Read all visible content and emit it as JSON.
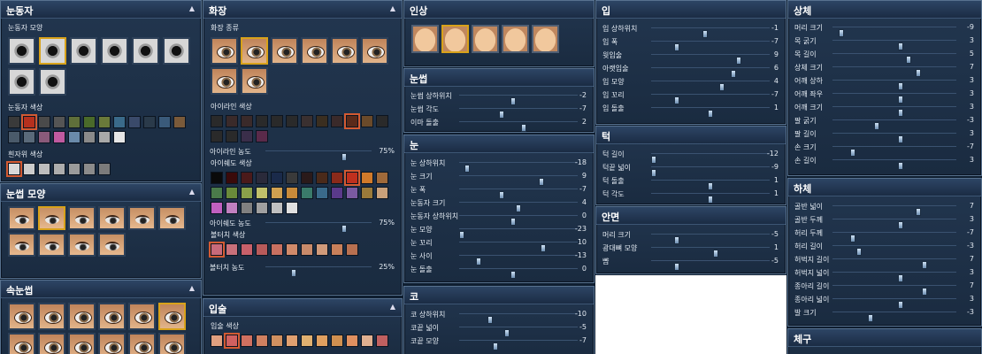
{
  "colors": {
    "accent": "#d8a21a",
    "selected_swatch": "#d35a32",
    "bg": "#0f1e30"
  },
  "col1": {
    "pupil": {
      "title": "눈동자",
      "shape_label": "눈동자 모양",
      "color_label": "눈동자 색상",
      "white_label": "흰자위 색상",
      "colors": [
        "#3a3a3a",
        "#b5301e",
        "#4a4a4a",
        "#555",
        "#5f6f3a",
        "#4a6a2a",
        "#6a7a3a",
        "#3a6a8a",
        "#3a4a6a",
        "#2a3a4a",
        "#3a5a7a",
        "#7a5a3a",
        "#4a5a6a",
        "#5a6a7a",
        "#8a5a7a",
        "#c05aa0",
        "#6a8aaa",
        "#8a8a8a",
        "#a9a9a9",
        "#e6e6e6"
      ],
      "whites": [
        "#d8d8d8",
        "#cccccc",
        "#bdbdbd",
        "#adadad",
        "#9b9b9b",
        "#8b8b8b",
        "#7b7b7b"
      ]
    },
    "eye_shape": {
      "title": "눈썹 모양"
    },
    "lashes": {
      "title": "속눈썹"
    }
  },
  "col2": {
    "makeup": {
      "title": "화장",
      "kind_label": "화장 종류",
      "liner_label": "아이라인 색상",
      "liner_density": "아이라인 농도",
      "liner_density_val": "75%",
      "liner_density_pos": 0.75,
      "shadow_label": "아이쉐도 색상",
      "shadow_density": "아이쉐도 농도",
      "shadow_density_val": "75%",
      "shadow_density_pos": 0.75,
      "blush_label": "볼터치 색상",
      "blush_density": "볼터치 농도",
      "blush_density_val": "25%",
      "blush_density_pos": 0.25,
      "liner": [
        "#2a2a2a",
        "#3a2a2a",
        "#3a2a2a",
        "#2a2a2a",
        "#2a2a2a",
        "#2a2a2a",
        "#3a3030",
        "#3a2e20",
        "#3a2a2a",
        "#5a2a1a",
        "#6a4a2a",
        "#2a2a2a",
        "#2a2a2a",
        "#2a2a2a",
        "#3a2e4a",
        "#5a2a4a"
      ],
      "shadow": [
        "#0a0a0a",
        "#3a0a0a",
        "#4a1a1a",
        "#2a2a3a",
        "#1a2a4a",
        "#3a3a3a",
        "#2a1a1a",
        "#4a2a1a",
        "#8a2a1a",
        "#c0301e",
        "#d07a2a",
        "#a06a3a",
        "#4a7a4a",
        "#6a8a3a",
        "#8aa04a",
        "#c0c06a",
        "#d0a050",
        "#c88a3a",
        "#3a7a6a",
        "#3a6a8a",
        "#5a3a8a",
        "#7a5aa0",
        "#9a7a3a",
        "#c8a07a",
        "#c060c0",
        "#c080c0",
        "#808080",
        "#a0a0a0",
        "#c0c0c0",
        "#e0e0e0"
      ],
      "blush": [
        "#c86a7a",
        "#c8707a",
        "#c8606a",
        "#b85a5a",
        "#c87060",
        "#d08a6a",
        "#c88a6a",
        "#d09a7a",
        "#c8805a",
        "#b87050"
      ]
    },
    "lips": {
      "title": "입술",
      "color_label": "입술 색상"
    }
  },
  "col3": {
    "impression": {
      "title": "인상"
    },
    "brows": {
      "title": "눈썹",
      "rows": [
        {
          "label": "눈썹 상하위치",
          "value": "-2",
          "pos": 0.45
        },
        {
          "label": "눈썹 각도",
          "value": "-7",
          "pos": 0.35
        },
        {
          "label": "이마 돌출",
          "value": "2",
          "pos": 0.55
        }
      ]
    },
    "eyes": {
      "title": "눈",
      "rows": [
        {
          "label": "눈 상하위치",
          "value": "-18",
          "pos": 0.05
        },
        {
          "label": "눈 크기",
          "value": "9",
          "pos": 0.7
        },
        {
          "label": "눈 폭",
          "value": "-7",
          "pos": 0.35
        },
        {
          "label": "눈동자 크기",
          "value": "4",
          "pos": 0.5
        },
        {
          "label": "눈동자 상하위치",
          "value": "0",
          "pos": 0.45
        },
        {
          "label": "눈 모양",
          "value": "-23",
          "pos": 0.0
        },
        {
          "label": "눈 꼬리",
          "value": "10",
          "pos": 0.72
        },
        {
          "label": "눈 사이",
          "value": "-13",
          "pos": 0.15
        },
        {
          "label": "눈 돌출",
          "value": "0",
          "pos": 0.45
        }
      ]
    },
    "nose": {
      "title": "코",
      "rows": [
        {
          "label": "코 상하위치",
          "value": "-10",
          "pos": 0.25
        },
        {
          "label": "코끝 넓이",
          "value": "-5",
          "pos": 0.4
        },
        {
          "label": "코끝 모양",
          "value": "-7",
          "pos": 0.3
        }
      ]
    }
  },
  "col4": {
    "mouth": {
      "title": "입",
      "rows": [
        {
          "label": "입 상하위치",
          "value": "-1",
          "pos": 0.45
        },
        {
          "label": "입 폭",
          "value": "-7",
          "pos": 0.2
        },
        {
          "label": "윗입술",
          "value": "9",
          "pos": 0.75
        },
        {
          "label": "아랫입술",
          "value": "6",
          "pos": 0.7
        },
        {
          "label": "입 모양",
          "value": "4",
          "pos": 0.6
        },
        {
          "label": "입 꼬리",
          "value": "-7",
          "pos": 0.2
        },
        {
          "label": "입 돌출",
          "value": "1",
          "pos": 0.5
        }
      ]
    },
    "chin": {
      "title": "턱",
      "rows": [
        {
          "label": "턱 길이",
          "value": "-12",
          "pos": 0.0
        },
        {
          "label": "턱끝 넓이",
          "value": "-9",
          "pos": 0.0
        },
        {
          "label": "턱 돌출",
          "value": "1",
          "pos": 0.5
        },
        {
          "label": "턱 각도",
          "value": "1",
          "pos": 0.5
        }
      ]
    },
    "side": {
      "title": "안면",
      "rows": [
        {
          "label": "머리 크기",
          "value": "-5",
          "pos": 0.2
        },
        {
          "label": "광대뼈 모양",
          "value": "1",
          "pos": 0.55
        },
        {
          "label": "뺨",
          "value": "-5",
          "pos": 0.2
        }
      ]
    }
  },
  "col5": {
    "upper": {
      "title": "상체",
      "rows": [
        {
          "label": "머리 크기",
          "value": "-9",
          "pos": 0.05
        },
        {
          "label": "목 굵기",
          "value": "3",
          "pos": 0.55
        },
        {
          "label": "목 길이",
          "value": "5",
          "pos": 0.62
        },
        {
          "label": "상체 크기",
          "value": "7",
          "pos": 0.7
        },
        {
          "label": "어깨 상하",
          "value": "3",
          "pos": 0.55
        },
        {
          "label": "어깨 좌우",
          "value": "3",
          "pos": 0.55
        },
        {
          "label": "어깨 크기",
          "value": "3",
          "pos": 0.55
        },
        {
          "label": "팔 굵기",
          "value": "-3",
          "pos": 0.35
        },
        {
          "label": "팔 길이",
          "value": "3",
          "pos": 0.55
        },
        {
          "label": "손 크기",
          "value": "-7",
          "pos": 0.15
        },
        {
          "label": "손 길이",
          "value": "3",
          "pos": 0.55
        }
      ]
    },
    "lower": {
      "title": "하체",
      "rows": [
        {
          "label": "골반 넓이",
          "value": "7",
          "pos": 0.7
        },
        {
          "label": "골반 두께",
          "value": "3",
          "pos": 0.55
        },
        {
          "label": "허리 두께",
          "value": "-7",
          "pos": 0.15
        },
        {
          "label": "허리 길이",
          "value": "-3",
          "pos": 0.2
        },
        {
          "label": "허벅지 길이",
          "value": "7",
          "pos": 0.75
        },
        {
          "label": "허벅지 넓이",
          "value": "3",
          "pos": 0.55
        },
        {
          "label": "종아리 길이",
          "value": "7",
          "pos": 0.75
        },
        {
          "label": "종아리 넓이",
          "value": "3",
          "pos": 0.55
        },
        {
          "label": "발 크기",
          "value": "-3",
          "pos": 0.3
        }
      ]
    },
    "body": {
      "title": "체구"
    }
  }
}
